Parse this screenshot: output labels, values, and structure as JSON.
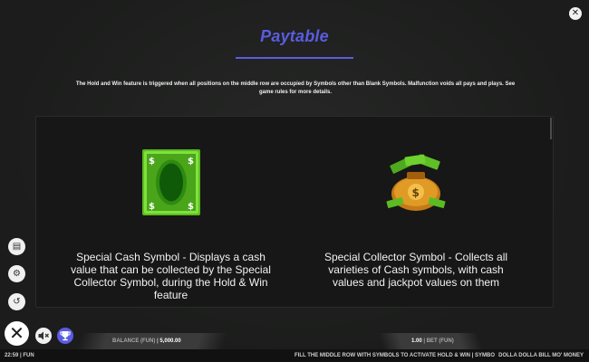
{
  "header": {
    "title": "Paytable",
    "close_icon": "close-icon"
  },
  "intro_text": "The Hold and Win feature is triggered when all positions on the middle row are occupied by Symbols other than Blank Symbols. Malfunction voids all pays and plays. See game rules for more details.",
  "symbols": [
    {
      "icon": "cash-banknote-icon",
      "desc": "Special Cash Symbol - Displays a cash value that can be collected by the Special Collector Symbol, during the Hold & Win feature"
    },
    {
      "icon": "money-bag-icon",
      "desc": "Special Collector Symbol - Collects all varieties of Cash symbols, with cash values and jackpot values on them"
    }
  ],
  "side_menu": [
    {
      "icon": "paytable-icon"
    },
    {
      "icon": "settings-gear-icon"
    },
    {
      "icon": "history-icon"
    }
  ],
  "footer": {
    "balance_label": "BALANCE (FUN)",
    "balance_value": "5,000.00",
    "bet_value": "1.00",
    "bet_label": "BET (FUN)",
    "time": "22:59",
    "mode": "FUN",
    "ticker": "FILL THE MIDDLE ROW WITH SYMBOLS TO ACTIVATE HOLD & WIN | SYMBO",
    "game_name": "DOLLA DOLLA BILL MO' MONEY"
  },
  "colors": {
    "accent": "#5a5ce0",
    "background": "#1c1d1c",
    "panel": "#161716",
    "cash_green": "#6fd12e"
  }
}
